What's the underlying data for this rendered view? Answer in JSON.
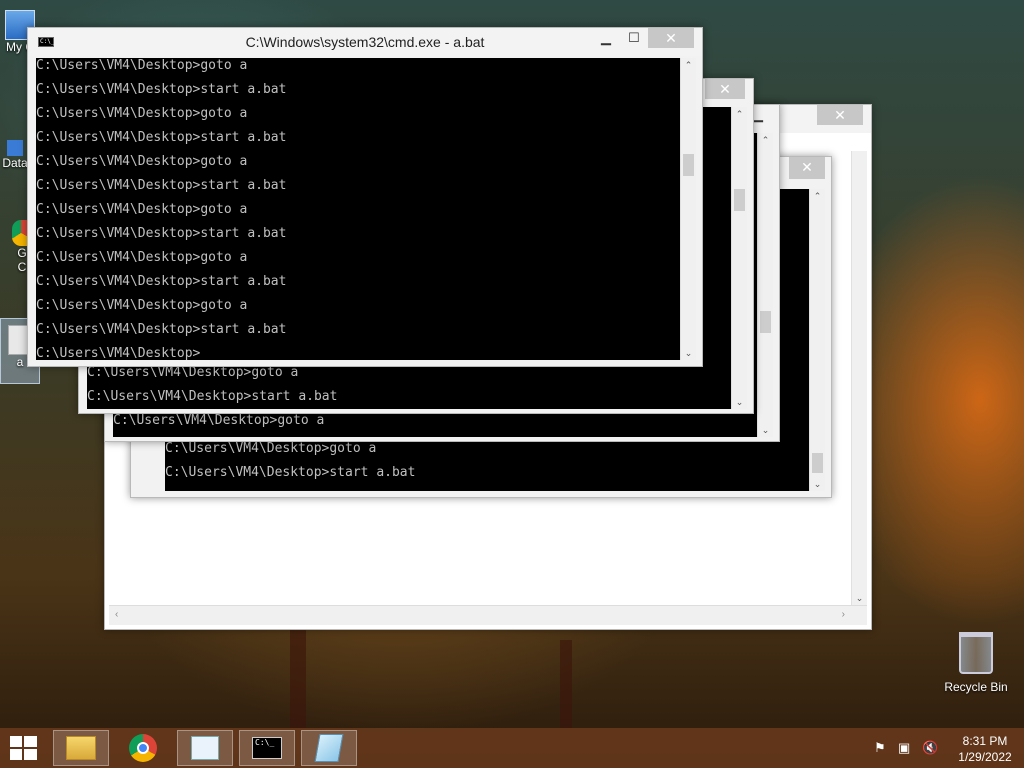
{
  "desktop": {
    "icons": {
      "my_computer": "My C",
      "data": "Data",
      "chrome_1": "G",
      "chrome_2": "C",
      "batch": "a",
      "recycle_bin": "Recycle Bin"
    }
  },
  "windows": {
    "front": {
      "title": "C:\\Windows\\system32\\cmd.exe - a.bat",
      "minimize": "▁",
      "maximize": "☐",
      "close": "✕",
      "lines": [
        "C:\\Users\\VM4\\Desktop>goto a",
        "C:\\Users\\VM4\\Desktop>start a.bat",
        "C:\\Users\\VM4\\Desktop>goto a",
        "C:\\Users\\VM4\\Desktop>start a.bat",
        "C:\\Users\\VM4\\Desktop>goto a",
        "C:\\Users\\VM4\\Desktop>start a.bat",
        "C:\\Users\\VM4\\Desktop>goto a",
        "C:\\Users\\VM4\\Desktop>start a.bat",
        "C:\\Users\\VM4\\Desktop>goto a",
        "C:\\Users\\VM4\\Desktop>start a.bat",
        "C:\\Users\\VM4\\Desktop>goto a",
        "C:\\Users\\VM4\\Desktop>start a.bat",
        "C:\\Users\\VM4\\Desktop>"
      ]
    },
    "second": {
      "lines": [
        "C:\\Users\\VM4\\Desktop>goto a",
        "C:\\Users\\VM4\\Desktop>start a.bat"
      ]
    },
    "third": {
      "lines": [
        "C:\\Users\\VM4\\Desktop>goto a"
      ]
    },
    "fifth": {
      "lines": [
        "C:\\Users\\VM4\\Desktop>goto a",
        "C:\\Users\\VM4\\Desktop>start a.bat"
      ]
    },
    "back": {
      "close": "✕",
      "minimize": "▁"
    }
  },
  "taskbar": {
    "start_icon": "windows-start-icon",
    "time": "8:31 PM",
    "date": "1/29/2022",
    "cmd_label": "C:\\_"
  }
}
